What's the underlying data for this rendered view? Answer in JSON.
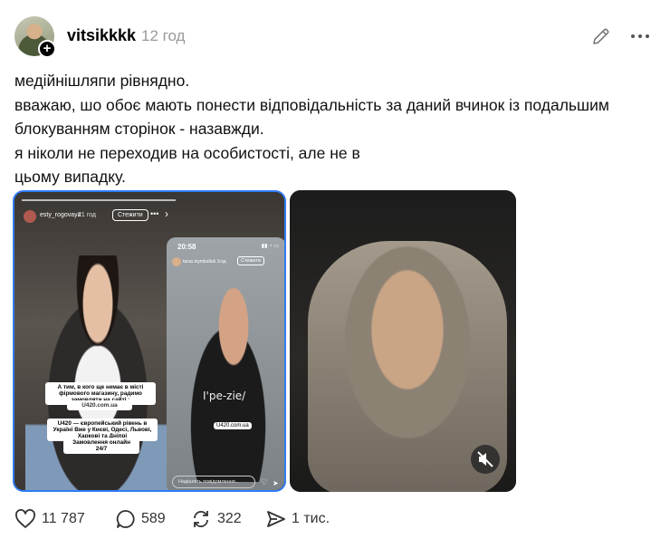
{
  "header": {
    "username": "vitsikkkk",
    "time": "12 год",
    "edit_icon": "pencil-icon",
    "more_icon": "ellipsis-icon"
  },
  "post": {
    "lines": [
      "медійнішляпи рівнядно.",
      "вважаю, шо обоє мають понести відповідальність за даний вчинок із подальшим блокуванням сторінок - назавжди.",
      "я ніколи не переходив на особистості, але не в",
      "цьому випадку."
    ]
  },
  "media_left": {
    "story_user": "esty_rogovaya",
    "story_time": "21 год",
    "follow_label": "Стежити",
    "caption1": "А тим, в кого ще немає в місті фірмового магазину, радимо замовляти на сайті :",
    "caption2": "U420.com.ua",
    "caption3": "U420 — європейський рівень в Україні Вже у Києві, Одесі, Львові, Харкові та Дніпрі",
    "caption4": "Замовлення онлайн 24/7",
    "phone_time": "20:58",
    "phone_user": "taras.tsymbaliuk",
    "phone_time_ago": "1год",
    "phone_follow": "Стежити",
    "shirt_text": "I'pe-zie/",
    "phone_tag": "U420.com.ua",
    "phone_input": "Надішліть повідомлення..."
  },
  "media_right": {
    "mute_icon": "speaker-muted-icon"
  },
  "actions": {
    "likes": "11 787",
    "replies": "589",
    "reposts": "322",
    "shares": "1 тис."
  }
}
